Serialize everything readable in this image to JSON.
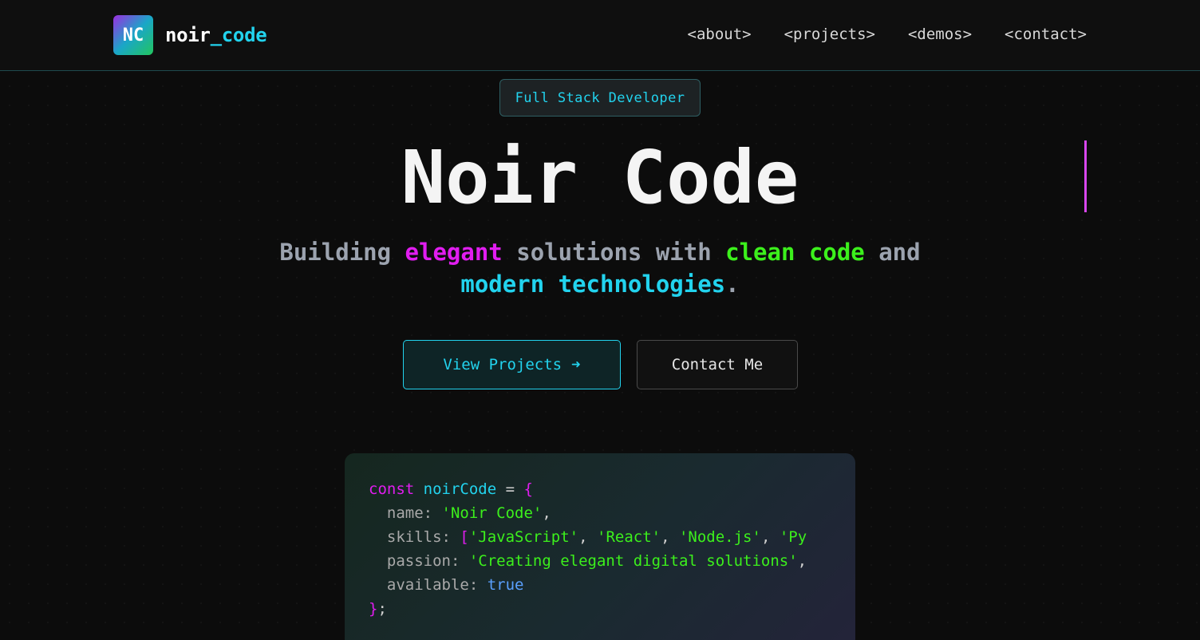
{
  "header": {
    "logo_badge": "NC",
    "logo_name": "noir",
    "logo_sep": "_",
    "logo_accent": "code",
    "nav": [
      "<about>",
      "<projects>",
      "<demos>",
      "<contact>"
    ]
  },
  "hero": {
    "tag": "Full Stack Developer",
    "title": "Noir Code",
    "subtitle": {
      "w1": "Building",
      "w2": "elegant",
      "w3": "solutions with",
      "w4": "clean code",
      "w5": "and",
      "w6": "modern technologies",
      "w7": "."
    },
    "primary_button": "View Projects",
    "primary_button_icon": "➜",
    "secondary_button": "Contact Me"
  },
  "code_card": {
    "l1_kw": "const",
    "l1_var": "noirCode",
    "l1_eq": " = ",
    "l1_brace": "{",
    "l2_key": "  name: ",
    "l2_val": "'Noir Code'",
    "l3_key": "  skills: ",
    "l3_open": "[",
    "l3_v1": "'JavaScript'",
    "l3_v2": "'React'",
    "l3_v3": "'Node.js'",
    "l3_v4": "'Py",
    "l4_key": "  passion: ",
    "l4_val": "'Creating elegant digital solutions'",
    "l5_key": "  available: ",
    "l5_val": "true",
    "l6_brace": "}",
    "l6_semi": ";"
  },
  "colors": {
    "accent_cyan": "#22d3ee",
    "accent_pink": "#e11df0",
    "accent_green": "#3cf01c",
    "background": "#0c0c0c"
  }
}
